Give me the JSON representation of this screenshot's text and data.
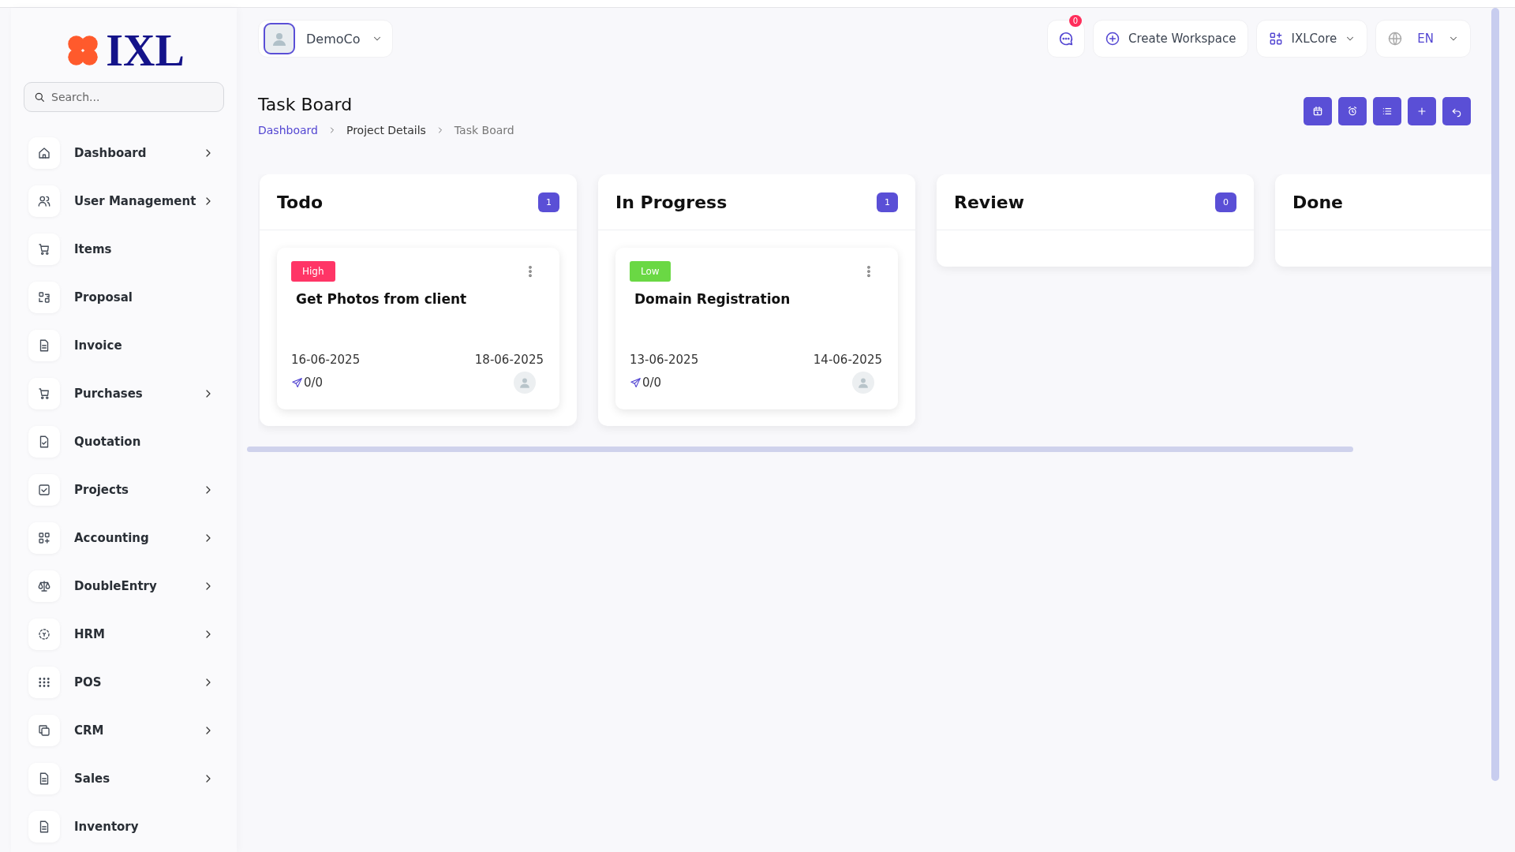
{
  "sidebar": {
    "logo": "IXL",
    "search": {
      "placeholder": "Search..."
    },
    "items": [
      {
        "label": "Dashboard",
        "has_submenu": true
      },
      {
        "label": "User Management",
        "has_submenu": true
      },
      {
        "label": "Items",
        "has_submenu": false
      },
      {
        "label": "Proposal",
        "has_submenu": false
      },
      {
        "label": "Invoice",
        "has_submenu": false
      },
      {
        "label": "Purchases",
        "has_submenu": true
      },
      {
        "label": "Quotation",
        "has_submenu": false
      },
      {
        "label": "Projects",
        "has_submenu": true
      },
      {
        "label": "Accounting",
        "has_submenu": true
      },
      {
        "label": "DoubleEntry",
        "has_submenu": true
      },
      {
        "label": "HRM",
        "has_submenu": true
      },
      {
        "label": "POS",
        "has_submenu": true
      },
      {
        "label": "CRM",
        "has_submenu": true
      },
      {
        "label": "Sales",
        "has_submenu": true
      },
      {
        "label": "Inventory",
        "has_submenu": false
      }
    ]
  },
  "header": {
    "company": "DemoCo",
    "messages_badge": "0",
    "create_workspace": "Create Workspace",
    "workspace": "IXLCore",
    "language": "EN"
  },
  "page": {
    "title": "Task Board",
    "breadcrumb": [
      {
        "label": "Dashboard",
        "link": true
      },
      {
        "label": "Project Details",
        "link": false
      },
      {
        "label": "Task Board",
        "link": false
      }
    ]
  },
  "board": {
    "columns": [
      {
        "title": "Todo",
        "count": "1",
        "tasks": [
          {
            "priority": {
              "label": "High",
              "kind": "high"
            },
            "title": "Get Photos from client",
            "start": "16-06-2025",
            "end": "18-06-2025",
            "progress": "0/0"
          }
        ]
      },
      {
        "title": "In Progress",
        "count": "1",
        "tasks": [
          {
            "priority": {
              "label": "Low",
              "kind": "low"
            },
            "title": "Domain Registration",
            "start": "13-06-2025",
            "end": "14-06-2025",
            "progress": "0/0"
          }
        ]
      },
      {
        "title": "Review",
        "count": "0"
      },
      {
        "title": "Done"
      }
    ]
  }
}
